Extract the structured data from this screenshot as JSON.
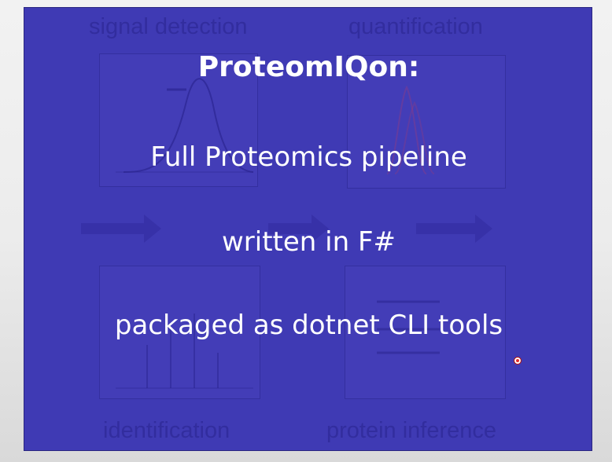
{
  "slide": {
    "title": "ProteomIQon:",
    "line1": "Full Proteomics pipeline",
    "line2": "written in F#",
    "line3": "packaged as dotnet CLI tools"
  },
  "background_figure": {
    "labels": {
      "top_left": "signal detection",
      "top_right": "quantification",
      "bottom_left": "identification",
      "bottom_right": "protein inference"
    }
  },
  "colors": {
    "slide_background": "#3f3ab4",
    "text": "#ffffff",
    "cursor": "#e22a2a"
  },
  "icons": {
    "cursor": "pointer-dot-icon"
  }
}
